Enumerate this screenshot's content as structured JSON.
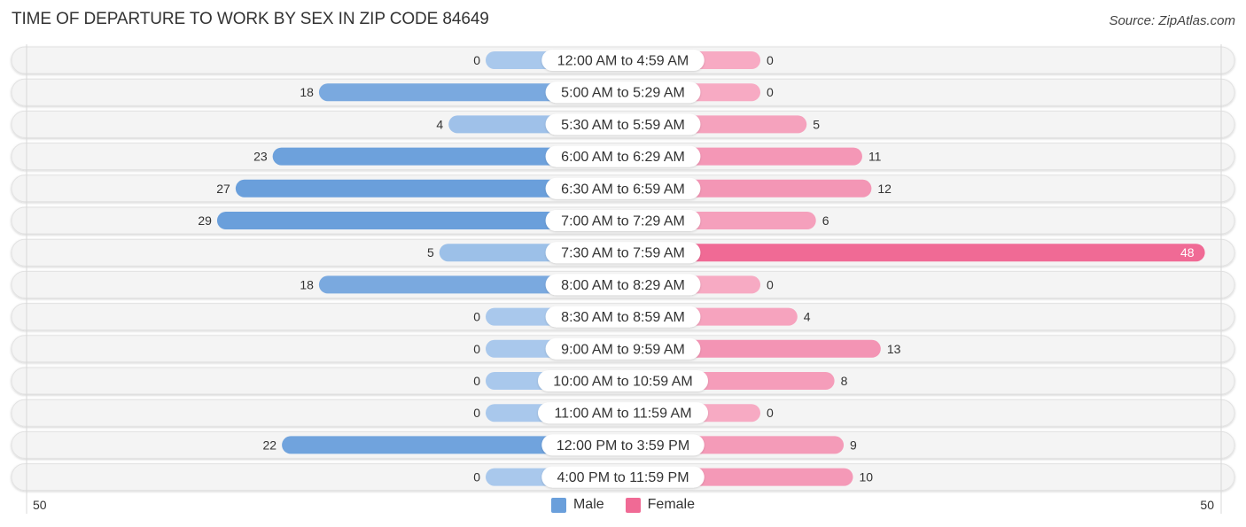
{
  "title": "TIME OF DEPARTURE TO WORK BY SEX IN ZIP CODE 84649",
  "source": "Source: ZipAtlas.com",
  "chart_data": {
    "type": "bar",
    "orientation": "horizontal-diverging",
    "title": "TIME OF DEPARTURE TO WORK BY SEX IN ZIP CODE 84649",
    "categories": [
      "12:00 AM to 4:59 AM",
      "5:00 AM to 5:29 AM",
      "5:30 AM to 5:59 AM",
      "6:00 AM to 6:29 AM",
      "6:30 AM to 6:59 AM",
      "7:00 AM to 7:29 AM",
      "7:30 AM to 7:59 AM",
      "8:00 AM to 8:29 AM",
      "8:30 AM to 8:59 AM",
      "9:00 AM to 9:59 AM",
      "10:00 AM to 10:59 AM",
      "11:00 AM to 11:59 AM",
      "12:00 PM to 3:59 PM",
      "4:00 PM to 11:59 PM"
    ],
    "series": [
      {
        "name": "Male",
        "color": "#6a9fdb",
        "values": [
          0,
          18,
          4,
          23,
          27,
          29,
          5,
          18,
          0,
          0,
          0,
          0,
          22,
          0
        ]
      },
      {
        "name": "Female",
        "color": "#f06a95",
        "values": [
          0,
          0,
          5,
          11,
          12,
          6,
          48,
          0,
          4,
          13,
          8,
          0,
          9,
          10
        ]
      }
    ],
    "xlim": [
      50,
      50
    ],
    "axis_tick_left": "50",
    "axis_tick_right": "50",
    "legend": [
      "Male",
      "Female"
    ],
    "legend_position": "bottom-center"
  },
  "legend": {
    "male_label": "Male",
    "female_label": "Female",
    "male_color": "#6a9fdb",
    "female_color": "#f06a95"
  },
  "axis": {
    "left_tick": "50",
    "right_tick": "50"
  }
}
